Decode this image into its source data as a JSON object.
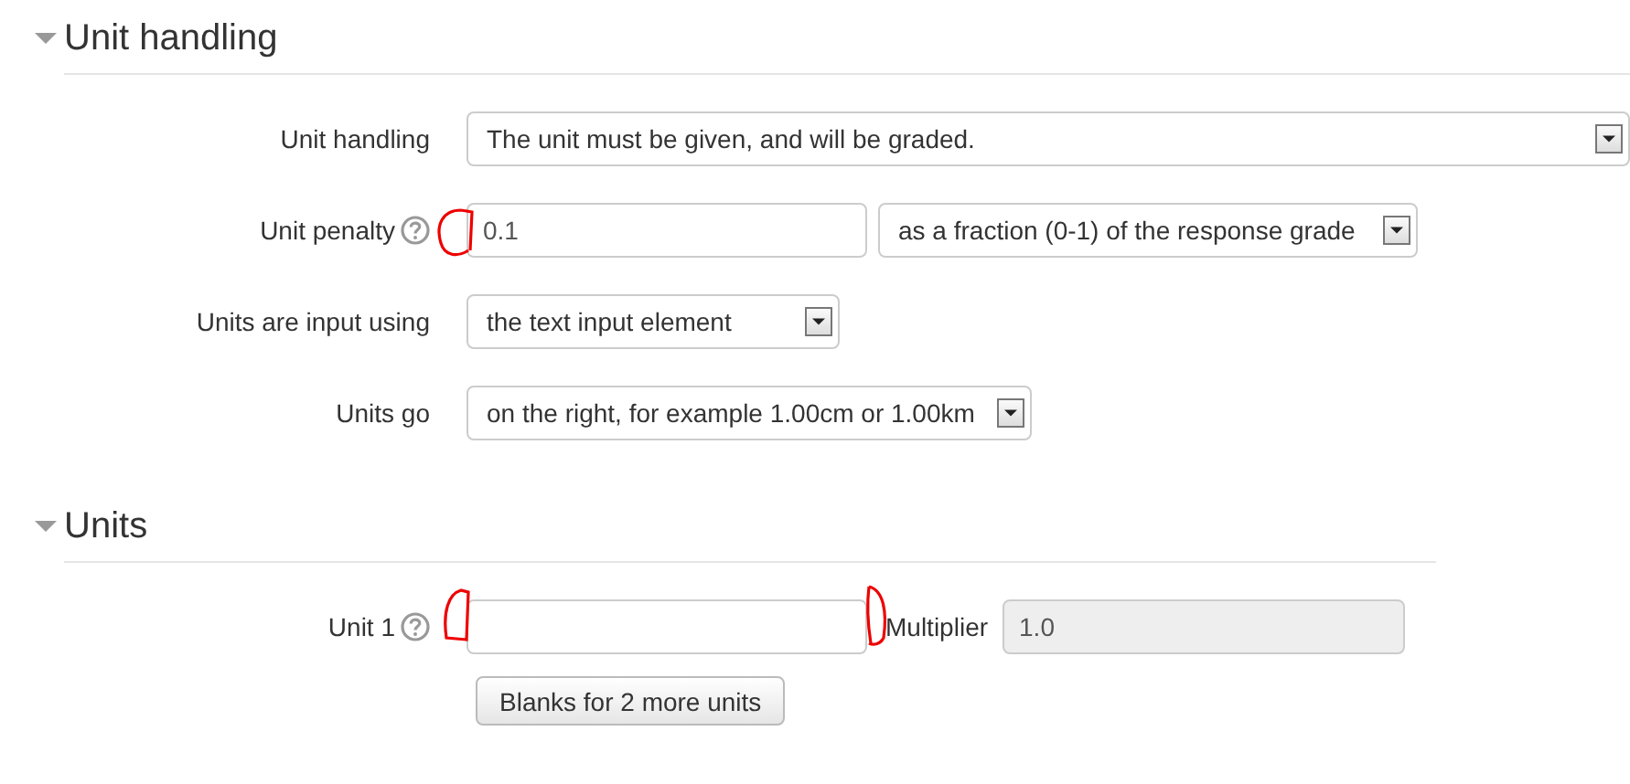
{
  "sections": [
    {
      "title": "Unit handling",
      "expanded": true,
      "rows": [
        {
          "label": "Unit handling",
          "controls": [
            {
              "kind": "select",
              "value": "The unit must be given, and will be graded."
            }
          ]
        },
        {
          "label": "Unit penalty",
          "help": true,
          "controls": [
            {
              "kind": "input",
              "value": "0.1"
            },
            {
              "kind": "select",
              "value": "as a fraction (0-1) of the response grade"
            }
          ]
        },
        {
          "label": "Units are input using",
          "controls": [
            {
              "kind": "select",
              "value": "the text input element"
            }
          ]
        },
        {
          "label": "Units go",
          "controls": [
            {
              "kind": "select",
              "value": "on the right, for example 1.00cm or 1.00km"
            }
          ]
        }
      ]
    },
    {
      "title": "Units",
      "expanded": true,
      "rows": [
        {
          "label": "Unit 1",
          "help": true,
          "controls": [
            {
              "kind": "input"
            },
            {
              "kind": "label",
              "text": "Multiplier"
            },
            {
              "kind": "input",
              "value": "1.0",
              "disabled": true
            }
          ]
        },
        {
          "controls": [
            {
              "kind": "button",
              "text": "Blanks for 2 more units"
            }
          ]
        }
      ]
    }
  ]
}
